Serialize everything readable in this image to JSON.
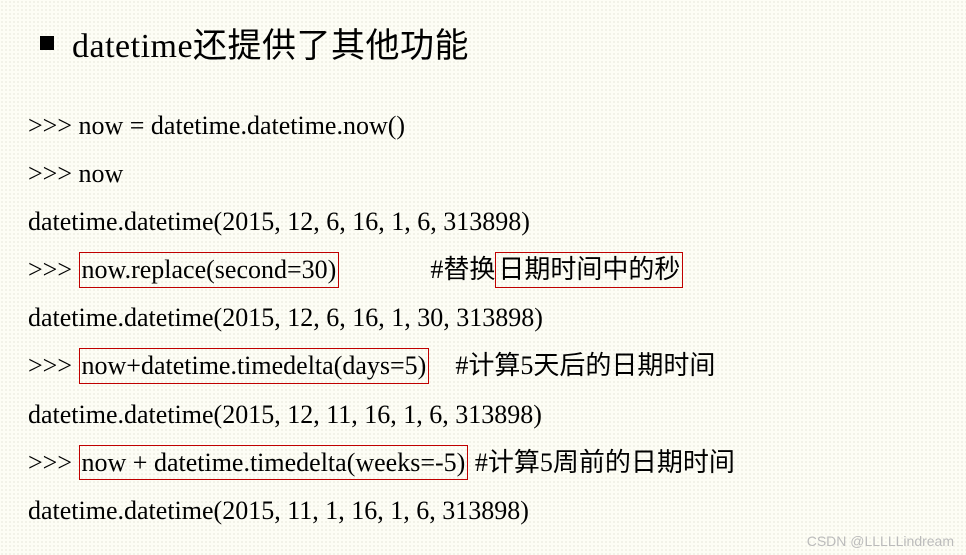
{
  "title": "datetime还提供了其他功能",
  "lines": {
    "l1": ">>> now = datetime.datetime.now()",
    "l2": ">>> now",
    "l3": "datetime.datetime(2015, 12, 6, 16, 1, 6, 313898)",
    "l4_prefix": ">>> ",
    "l4_box": "now.replace(second=30)",
    "l4_gap": "              #替换",
    "l4_box2": "日期时间中的秒",
    "l5": "datetime.datetime(2015, 12, 6, 16, 1, 30, 313898)",
    "l6_prefix": ">>> ",
    "l6_box": "now+datetime.timedelta(days=5)",
    "l6_comment": "    #计算5天后的日期时间",
    "l7": "datetime.datetime(2015, 12, 11, 16, 1, 6, 313898)",
    "l8_prefix": ">>> ",
    "l8_box": "now + datetime.timedelta(weeks=-5)",
    "l8_comment": " #计算5周前的日期时间",
    "l9": "datetime.datetime(2015, 11, 1, 16, 1, 6, 313898)"
  },
  "watermark": "CSDN @LLLLLindream"
}
